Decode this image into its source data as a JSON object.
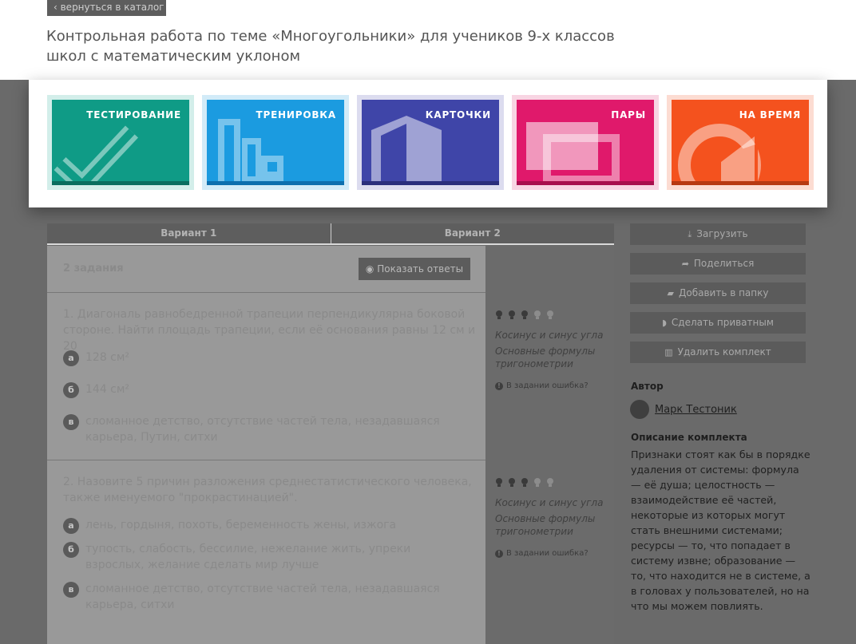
{
  "nav": {
    "back_label": "‹ вернуться в каталог"
  },
  "page": {
    "title": "Контрольная работа по теме «Многоугольники» для учеников 9-х классов школ с математическим уклоном"
  },
  "modes": [
    {
      "label": "ТЕСТИРОВАНИЕ",
      "icon": "checkmark-icon",
      "color": "#0f9b86",
      "bar": "#0a6e5f",
      "frame": "#d3eeea"
    },
    {
      "label": "ТРЕНИРОВКА",
      "icon": "bar-chart-icon",
      "color": "#1b9be0",
      "bar": "#0d6fae",
      "frame": "#d2ebf8"
    },
    {
      "label": "КАРТОЧКИ",
      "icon": "cards-icon",
      "color": "#3f45a8",
      "bar": "#2b2f7c",
      "frame": "#dcdcef"
    },
    {
      "label": "ПАРЫ",
      "icon": "pairs-icon",
      "color": "#e0196b",
      "bar": "#a80f4e",
      "frame": "#f8d5e3"
    },
    {
      "label": "НА ВРЕМЯ",
      "icon": "timer-icon",
      "color": "#f4521e",
      "bar": "#b73a12",
      "frame": "#fcdcd2"
    }
  ],
  "variants": [
    {
      "label": "Вариант 1"
    },
    {
      "label": "Вариант 2"
    }
  ],
  "tasks": {
    "count_label": "2 задания",
    "show_answers_label": "Показать ответы",
    "items": [
      {
        "question": "1. Диагональ равнобедренной трапеции перпендикулярна боковой стороне. Найти площадь трапеции, если её основания равны 12 см и 20",
        "answers": [
          {
            "letter": "а",
            "text": "128 см²"
          },
          {
            "letter": "б",
            "text": "144 см²"
          },
          {
            "letter": "в",
            "text": "сломанное детство, отсутствие частей тела, незадавшаяся карьера, Путин, ситхи"
          }
        ],
        "topics": [
          "Косинус и синус угла",
          "Основные формулы тригонометрии"
        ],
        "error_label": "В задании ошибка?"
      },
      {
        "question": "2. Назовите 5 причин разложения среднестатистического человека, также именуемого \"прокрастинацией\".",
        "answers": [
          {
            "letter": "а",
            "text": "лень, гордыня, похоть, беременность жены, изжога"
          },
          {
            "letter": "б",
            "text": "тупость, слабость, бессилие, нежелание жить, упреки взрослых, желание сделать мир лучше"
          },
          {
            "letter": "в",
            "text": "сломанное детство, отсутствие частей тела, незадавшаяся карьера, ситхи"
          }
        ],
        "topics": [
          "Косинус и синус угла",
          "Основные формулы тригонометрии"
        ],
        "error_label": "В задании ошибка?"
      }
    ]
  },
  "actions": [
    {
      "label": "Загрузить",
      "icon": "download-icon"
    },
    {
      "label": "Поделиться",
      "icon": "share-icon"
    },
    {
      "label": "Добавить в папку",
      "icon": "folder-icon"
    },
    {
      "label": "Сделать приватным",
      "icon": "shield-icon"
    },
    {
      "label": "Удалить комплект",
      "icon": "trash-icon"
    }
  ],
  "author": {
    "heading": "Автор",
    "name": "Марк Тестоник"
  },
  "description": {
    "heading": "Описание комплекта",
    "text": "Признаки стоят как бы в порядке удаления от системы: формула — её душа; целостность — взаимодействие её частей, некоторые из которых могут стать внешними системами; ресурсы — то, что попадает в систему извне; образование — то, что находится не в системе, а в головах у пользователей, но на что мы можем повлиять."
  }
}
